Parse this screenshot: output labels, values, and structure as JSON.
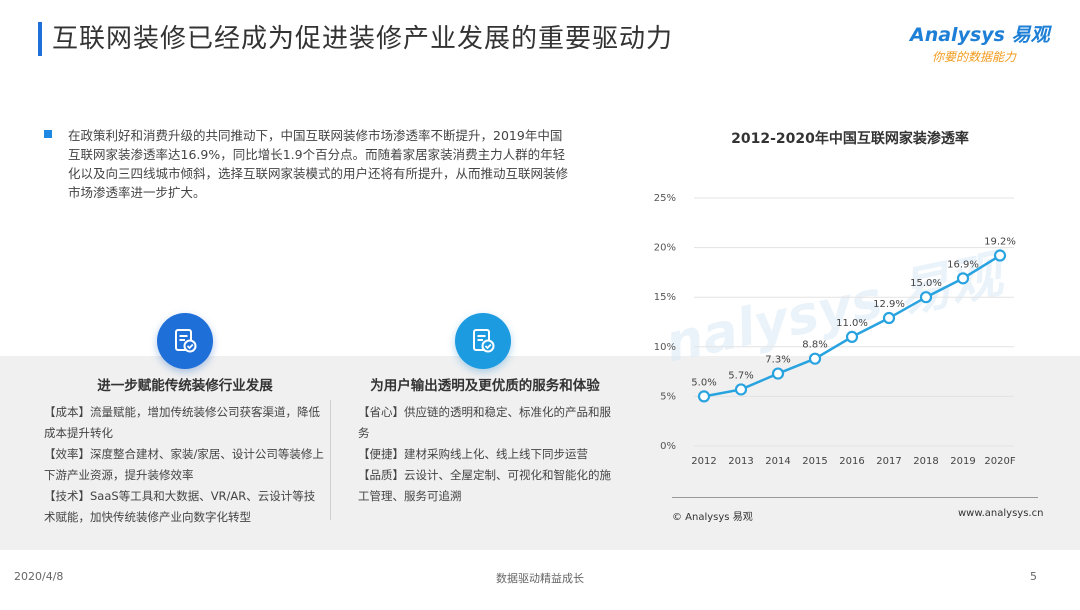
{
  "title": "互联网装修已经成为促进装修产业发展的重要驱动力",
  "logo": {
    "main": "Analysys 易观",
    "sub": "你要的数据能力"
  },
  "intro": "在政策利好和消费升级的共同推动下，中国互联网装修市场渗透率不断提升，2019年中国互联网家装渗透率达16.9%，同比增长1.9个百分点。而随着家居家装消费主力人群的年轻化以及向三四线城市倾斜，选择互联网家装模式的用户还将有所提升，从而推动互联网装修市场渗透率进一步扩大。",
  "cards": [
    {
      "icon": "checklist-icon",
      "title": "进一步赋能传统装修行业发展",
      "lines": [
        "【成本】流量赋能，增加传统装修公司获客渠道，降低成本提升转化",
        "【效率】深度整合建材、家装/家居、设计公司等装修上下游产业资源，提升装修效率",
        "【技术】SaaS等工具和大数据、VR/AR、云设计等技术赋能，加快传统装修产业向数字化转型"
      ]
    },
    {
      "icon": "checklist-icon",
      "title": "为用户输出透明及更优质的服务和体验",
      "lines": [
        "【省心】供应链的透明和稳定、标准化的产品和服务",
        "【便捷】建材采购线上化、线上线下同步运营",
        "【品质】云设计、全屋定制、可视化和智能化的施工管理、服务可追溯"
      ]
    }
  ],
  "chart_data": {
    "type": "line",
    "title": "2012-2020年中国互联网家装渗透率",
    "categories": [
      "2012",
      "2013",
      "2014",
      "2015",
      "2016",
      "2017",
      "2018",
      "2019",
      "2020F"
    ],
    "values": [
      5.0,
      5.7,
      7.3,
      8.8,
      11.0,
      12.9,
      15.0,
      16.9,
      19.2
    ],
    "data_labels": [
      "5.0%",
      "5.7%",
      "7.3%",
      "8.8%",
      "11.0%",
      "12.9%",
      "15.0%",
      "16.9%",
      "19.2%"
    ],
    "y_ticks": [
      "0%",
      "5%",
      "10%",
      "15%",
      "20%",
      "25%"
    ],
    "ylim": [
      0,
      25
    ],
    "grid": true,
    "legend": "none",
    "color": "#29a3e0",
    "source_left": "© Analysys 易观",
    "source_right": "www.analysys.cn"
  },
  "footer": {
    "date": "2020/4/8",
    "center": "数据驱动精益成长",
    "page": "5"
  }
}
